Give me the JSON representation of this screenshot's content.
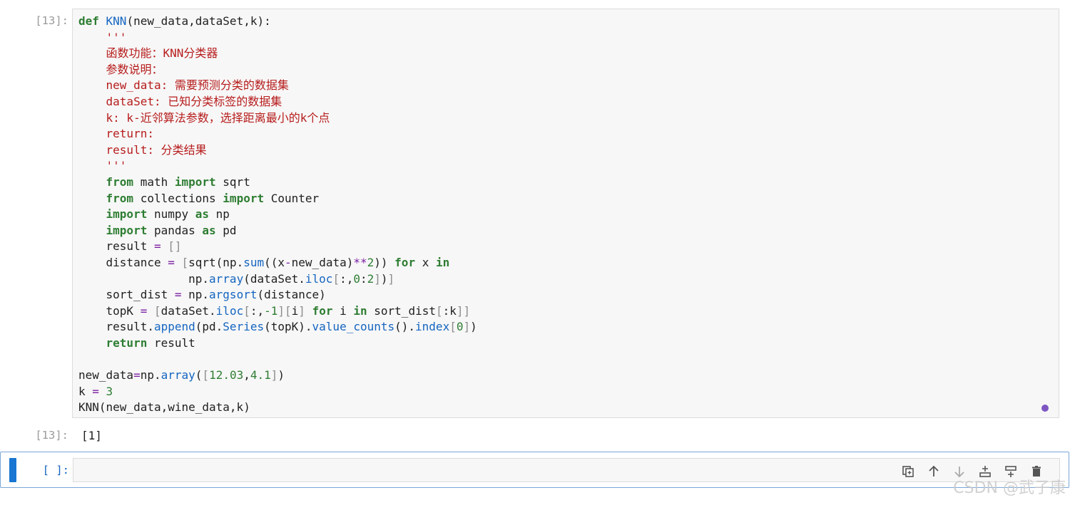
{
  "cell1": {
    "prompt": "[13]:",
    "lines": [
      [
        {
          "t": "def ",
          "c": "kw"
        },
        {
          "t": "KNN",
          "c": "fn"
        },
        {
          "t": "(new_data,dataSet,k):",
          "c": ""
        }
      ],
      [
        {
          "t": "    '''",
          "c": "str"
        }
      ],
      [
        {
          "t": "    函数功能：KNN分类器",
          "c": "str"
        }
      ],
      [
        {
          "t": "    参数说明：",
          "c": "str"
        }
      ],
      [
        {
          "t": "    new_data: 需要预测分类的数据集",
          "c": "str"
        }
      ],
      [
        {
          "t": "    dataSet: 已知分类标签的数据集",
          "c": "str"
        }
      ],
      [
        {
          "t": "    k: k-近邻算法参数，选择距离最小的k个点",
          "c": "str"
        }
      ],
      [
        {
          "t": "    return:",
          "c": "str"
        }
      ],
      [
        {
          "t": "    result: 分类结果",
          "c": "str"
        }
      ],
      [
        {
          "t": "    '''",
          "c": "str"
        }
      ],
      [
        {
          "t": "    ",
          "c": ""
        },
        {
          "t": "from",
          "c": "kw"
        },
        {
          "t": " math ",
          "c": ""
        },
        {
          "t": "import",
          "c": "kw"
        },
        {
          "t": " sqrt",
          "c": ""
        }
      ],
      [
        {
          "t": "    ",
          "c": ""
        },
        {
          "t": "from",
          "c": "kw"
        },
        {
          "t": " collections ",
          "c": ""
        },
        {
          "t": "import",
          "c": "kw"
        },
        {
          "t": " Counter",
          "c": ""
        }
      ],
      [
        {
          "t": "    ",
          "c": ""
        },
        {
          "t": "import",
          "c": "kw"
        },
        {
          "t": " numpy ",
          "c": ""
        },
        {
          "t": "as",
          "c": "kw"
        },
        {
          "t": " np",
          "c": ""
        }
      ],
      [
        {
          "t": "    ",
          "c": ""
        },
        {
          "t": "import",
          "c": "kw"
        },
        {
          "t": " pandas ",
          "c": ""
        },
        {
          "t": "as",
          "c": "kw"
        },
        {
          "t": " pd",
          "c": ""
        }
      ],
      [
        {
          "t": "    result ",
          "c": ""
        },
        {
          "t": "=",
          "c": "op"
        },
        {
          "t": " []",
          "c": "br"
        }
      ],
      [
        {
          "t": "    distance ",
          "c": ""
        },
        {
          "t": "=",
          "c": "op"
        },
        {
          "t": " [",
          "c": "br"
        },
        {
          "t": "sqrt(np.",
          "c": ""
        },
        {
          "t": "sum",
          "c": "at"
        },
        {
          "t": "((x",
          "c": ""
        },
        {
          "t": "-",
          "c": "op"
        },
        {
          "t": "new_data)",
          "c": ""
        },
        {
          "t": "**",
          "c": "op"
        },
        {
          "t": "2",
          "c": "num"
        },
        {
          "t": ")) ",
          "c": ""
        },
        {
          "t": "for",
          "c": "kw"
        },
        {
          "t": " x ",
          "c": ""
        },
        {
          "t": "in",
          "c": "kw"
        }
      ],
      [
        {
          "t": "                np.",
          "c": ""
        },
        {
          "t": "array",
          "c": "at"
        },
        {
          "t": "(dataSet.",
          "c": ""
        },
        {
          "t": "iloc",
          "c": "at"
        },
        {
          "t": "[",
          "c": "br"
        },
        {
          "t": ":,",
          "c": ""
        },
        {
          "t": "0",
          "c": "num"
        },
        {
          "t": ":",
          "c": ""
        },
        {
          "t": "2",
          "c": "num"
        },
        {
          "t": "]",
          "c": "br"
        },
        {
          "t": ")",
          "c": ""
        },
        {
          "t": "]",
          "c": "br"
        }
      ],
      [
        {
          "t": "    sort_dist ",
          "c": ""
        },
        {
          "t": "=",
          "c": "op"
        },
        {
          "t": " np.",
          "c": ""
        },
        {
          "t": "argsort",
          "c": "at"
        },
        {
          "t": "(distance)",
          "c": ""
        }
      ],
      [
        {
          "t": "    topK ",
          "c": ""
        },
        {
          "t": "=",
          "c": "op"
        },
        {
          "t": " [",
          "c": "br"
        },
        {
          "t": "dataSet.",
          "c": ""
        },
        {
          "t": "iloc",
          "c": "at"
        },
        {
          "t": "[",
          "c": "br"
        },
        {
          "t": ":,",
          "c": ""
        },
        {
          "t": "-1",
          "c": "num"
        },
        {
          "t": "][",
          "c": "br"
        },
        {
          "t": "i",
          "c": ""
        },
        {
          "t": "]",
          "c": "br"
        },
        {
          "t": " ",
          "c": ""
        },
        {
          "t": "for",
          "c": "kw"
        },
        {
          "t": " i ",
          "c": ""
        },
        {
          "t": "in",
          "c": "kw"
        },
        {
          "t": " sort_dist",
          "c": ""
        },
        {
          "t": "[",
          "c": "br"
        },
        {
          "t": ":k",
          "c": ""
        },
        {
          "t": "]]",
          "c": "br"
        }
      ],
      [
        {
          "t": "    result.",
          "c": ""
        },
        {
          "t": "append",
          "c": "at"
        },
        {
          "t": "(pd.",
          "c": ""
        },
        {
          "t": "Series",
          "c": "at"
        },
        {
          "t": "(topK).",
          "c": ""
        },
        {
          "t": "value_counts",
          "c": "at"
        },
        {
          "t": "().",
          "c": ""
        },
        {
          "t": "index",
          "c": "at"
        },
        {
          "t": "[",
          "c": "br"
        },
        {
          "t": "0",
          "c": "num"
        },
        {
          "t": "]",
          "c": "br"
        },
        {
          "t": ")",
          "c": ""
        }
      ],
      [
        {
          "t": "    ",
          "c": ""
        },
        {
          "t": "return",
          "c": "kw"
        },
        {
          "t": " result",
          "c": ""
        }
      ],
      [
        {
          "t": "",
          "c": ""
        }
      ],
      [
        {
          "t": "new_data",
          "c": ""
        },
        {
          "t": "=",
          "c": "op"
        },
        {
          "t": "np.",
          "c": ""
        },
        {
          "t": "array",
          "c": "at"
        },
        {
          "t": "(",
          "c": ""
        },
        {
          "t": "[",
          "c": "br"
        },
        {
          "t": "12.03",
          "c": "num"
        },
        {
          "t": ",",
          "c": ""
        },
        {
          "t": "4.1",
          "c": "num"
        },
        {
          "t": "]",
          "c": "br"
        },
        {
          "t": ")",
          "c": ""
        }
      ],
      [
        {
          "t": "k ",
          "c": ""
        },
        {
          "t": "=",
          "c": "op"
        },
        {
          "t": " ",
          "c": ""
        },
        {
          "t": "3",
          "c": "num"
        }
      ],
      [
        {
          "t": "KNN(new_data,wine_data,k)",
          "c": ""
        }
      ]
    ]
  },
  "output": {
    "prompt": "[13]:",
    "text": "[1]"
  },
  "active_cell": {
    "prompt": "[ ]:",
    "toolbar": [
      "duplicate-icon",
      "move-up-icon",
      "move-down-icon",
      "insert-below-icon",
      "insert-above-icon",
      "delete-icon"
    ]
  },
  "accent": "#1976d2",
  "watermark": "CSDN @武子康"
}
